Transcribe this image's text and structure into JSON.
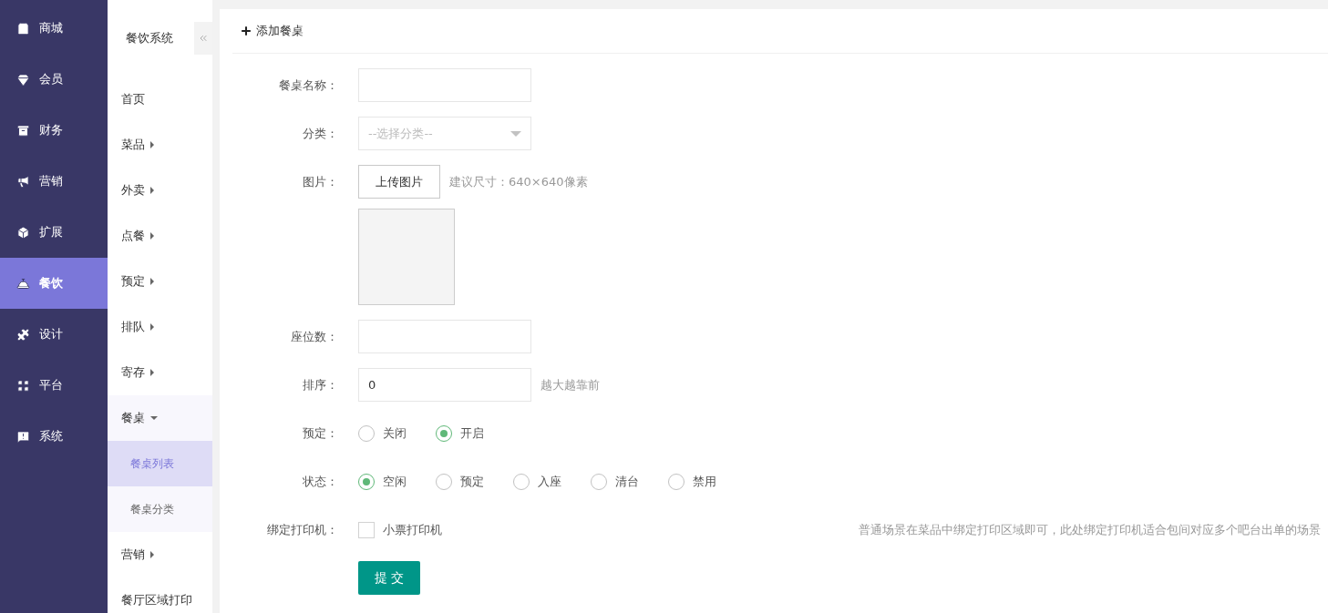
{
  "main_nav": [
    {
      "label": "商城",
      "selected": false
    },
    {
      "label": "会员",
      "selected": false
    },
    {
      "label": "财务",
      "selected": false
    },
    {
      "label": "营销",
      "selected": false
    },
    {
      "label": "扩展",
      "selected": false
    },
    {
      "label": "餐饮",
      "selected": true
    },
    {
      "label": "设计",
      "selected": false
    },
    {
      "label": "平台",
      "selected": false
    },
    {
      "label": "系统",
      "selected": false
    }
  ],
  "sub_nav": {
    "title": "餐饮系统",
    "items": [
      {
        "label": "首页",
        "kind": "link"
      },
      {
        "label": "菜品",
        "kind": "group",
        "expanded": false
      },
      {
        "label": "外卖",
        "kind": "group",
        "expanded": false
      },
      {
        "label": "点餐",
        "kind": "group",
        "expanded": false
      },
      {
        "label": "预定",
        "kind": "group",
        "expanded": false
      },
      {
        "label": "排队",
        "kind": "group",
        "expanded": false
      },
      {
        "label": "寄存",
        "kind": "group",
        "expanded": false
      },
      {
        "label": "餐桌",
        "kind": "group",
        "expanded": true,
        "children": [
          {
            "label": "餐桌列表",
            "selected": true
          },
          {
            "label": "餐桌分类",
            "selected": false
          }
        ]
      },
      {
        "label": "营销",
        "kind": "group",
        "expanded": false
      },
      {
        "label": "餐厅区域打印",
        "kind": "link"
      }
    ]
  },
  "panel": {
    "heading": "添加餐桌",
    "fields": [
      {
        "kind": "text",
        "label": "餐桌名称："
      },
      {
        "kind": "select",
        "label": "分类：",
        "placeholder": "--选择分类--"
      },
      {
        "kind": "image",
        "label": "图片：",
        "button": "上传图片",
        "hint": "建议尺寸：640×640像素"
      },
      {
        "kind": "text",
        "label": "座位数："
      },
      {
        "kind": "text",
        "label": "排序：",
        "value": "0",
        "hint": "越大越靠前"
      },
      {
        "kind": "radio",
        "label": "预定：",
        "options": [
          {
            "label": "关闭",
            "selected": false
          },
          {
            "label": "开启",
            "selected": true
          }
        ]
      },
      {
        "kind": "radio",
        "label": "状态：",
        "options": [
          {
            "label": "空闲",
            "selected": true
          },
          {
            "label": "预定",
            "selected": false
          },
          {
            "label": "入座",
            "selected": false
          },
          {
            "label": "清台",
            "selected": false
          },
          {
            "label": "禁用",
            "selected": false
          }
        ]
      },
      {
        "kind": "checkbox",
        "label": "绑定打印机：",
        "options": [
          {
            "label": "小票打印机",
            "checked": false
          }
        ],
        "hint": "普通场景在菜品中绑定打印区域即可，此处绑定打印机适合包间对应多个吧台出单的场景"
      }
    ],
    "submit": "提 交"
  }
}
